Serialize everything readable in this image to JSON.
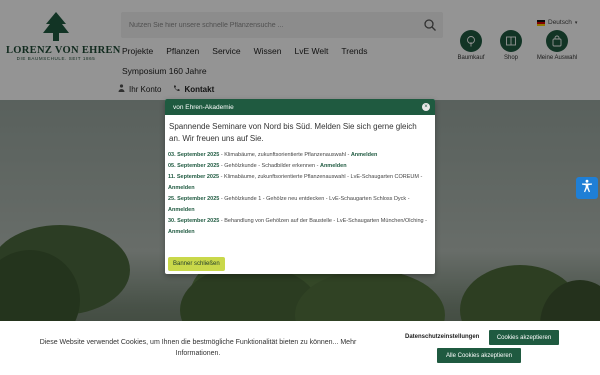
{
  "logo": {
    "name": "LORENZ VON EHREN",
    "tagline": "DIE BAUMSCHULE. SEIT 1865"
  },
  "search": {
    "placeholder": "Nutzen Sie hier unsere schnelle Pflanzensuche ..."
  },
  "language": {
    "label": "Deutsch"
  },
  "header_icons": [
    {
      "label": "Baumkauf",
      "icon": "tree-icon"
    },
    {
      "label": "Shop",
      "icon": "book-icon"
    },
    {
      "label": "Meine Auswahl",
      "icon": "bag-icon"
    }
  ],
  "nav": {
    "items": [
      "Projekte",
      "Pflanzen",
      "Service",
      "Wissen",
      "LvE Welt",
      "Trends"
    ],
    "second_row": "Symposium 160 Jahre"
  },
  "subnav": {
    "account": "Ihr Konto",
    "contact": "Kontakt"
  },
  "modal": {
    "title": "von Ehren-Akademie",
    "close_symbol": "×",
    "intro": "Spannende Seminare von Nord bis Süd. Melden Sie sich gerne gleich an. Wir freuen uns auf Sie.",
    "events": [
      {
        "date": "03. September 2025",
        "text": " - Klimabäume, zukunftsorientierte Pflanzenauswahl - ",
        "link": "Anmelden"
      },
      {
        "date": "05. September 2025",
        "text": " - Gehölzkunde - Schadbilder erkennen - ",
        "link": "Anmelden"
      },
      {
        "date": "11. September 2025",
        "text": " - Klimabäume, zukunftsorientierte Pflanzenauswahl - LvE-Schaugarten COREUM - ",
        "link": "Anmelden"
      },
      {
        "date": "25. September 2025",
        "text": " - Gehölzkunde 1 - Gehölze neu entdecken - LvE-Schaugarten Schloss Dyck - ",
        "link": "Anmelden"
      },
      {
        "date": "30. September 2025",
        "text": " - Behandlung von Gehölzen auf der Baustelle - LvE-Schaugarten München/Olching - ",
        "link": "Anmelden"
      }
    ],
    "close_button": "Banner schließen"
  },
  "cookie": {
    "text": "Diese Website verwendet Cookies, um Ihnen die bestmögliche Funktionalität bieten zu können... Mehr Informationen.",
    "settings": "Datenschutzeinstellungen",
    "accept": "Cookies akzeptieren",
    "accept_all": "Alle Cookies akzeptieren"
  },
  "colors": {
    "brand_green": "#1f5a40",
    "lime_button": "#c9d84a",
    "accessibility_blue": "#1f7fd6"
  }
}
